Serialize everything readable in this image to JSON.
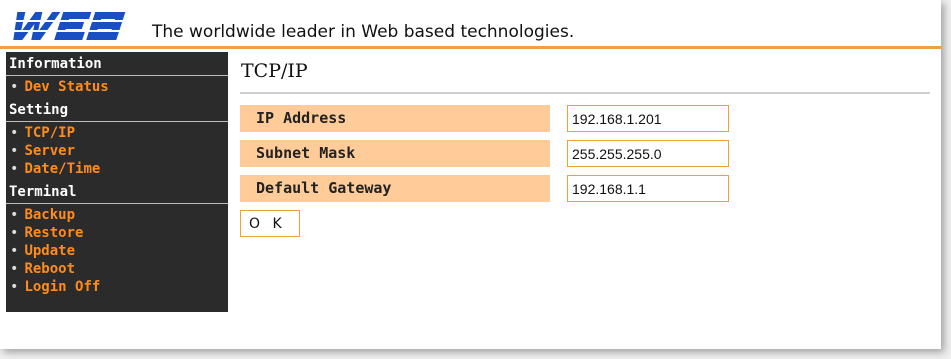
{
  "header": {
    "logo_text": "WEB",
    "tagline": "The worldwide leader in Web based technologies."
  },
  "sidebar": {
    "sections": [
      {
        "title": "Information",
        "items": [
          "Dev Status"
        ]
      },
      {
        "title": "Setting",
        "items": [
          "TCP/IP",
          "Server",
          "Date/Time"
        ]
      },
      {
        "title": "Terminal",
        "items": [
          "Backup",
          "Restore",
          "Update",
          "Reboot",
          "Login Off"
        ]
      }
    ]
  },
  "main": {
    "title": "TCP/IP",
    "fields": [
      {
        "label": "IP Address",
        "value": "192.168.1.201"
      },
      {
        "label": "Subnet Mask",
        "value": "255.255.255.0"
      },
      {
        "label": "Default Gateway",
        "value": "192.168.1.1"
      }
    ],
    "ok_label": "O K"
  },
  "colors": {
    "accent": "#f0a040",
    "nav_link": "#ff8c1a",
    "label_bg": "#ffcc99",
    "sidebar_bg": "#2b2b2b"
  }
}
